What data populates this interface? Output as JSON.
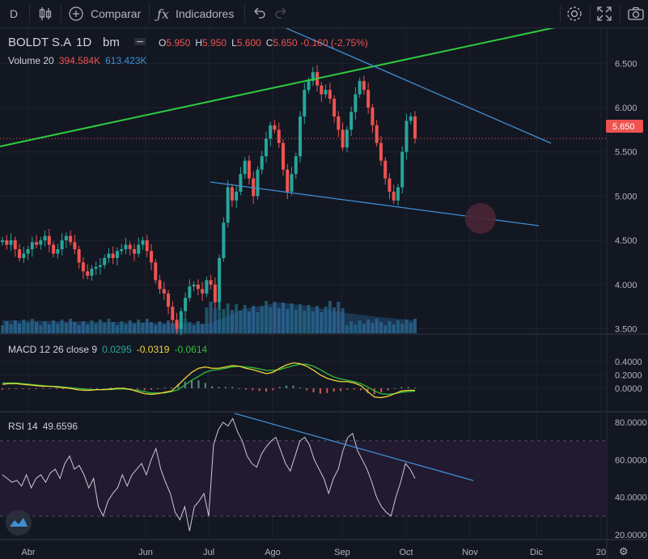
{
  "toolbar": {
    "symbol_short": "D",
    "compare_label": "Comparar",
    "indicators_label": "Indicadores"
  },
  "legend": {
    "symbol": "BOLDT S.A",
    "interval": "1D",
    "scale": "bm",
    "open_label": "O",
    "open": "5.950",
    "high_label": "H",
    "high": "5.950",
    "low_label": "L",
    "low": "5.600",
    "close_label": "C",
    "close": "5.650",
    "change": "-0.160 (-2.75%)",
    "volume_label": "Volume 20",
    "volume_value": "394.584K",
    "volume_ma": "613.423K",
    "macd_label": "MACD 12 26 close 9",
    "macd_hist": "0.0295",
    "macd_line": "-0.0319",
    "macd_signal": "-0.0614",
    "rsi_label": "RSI 14",
    "rsi_value": "49.6596"
  },
  "price_tag": "5.650",
  "colors": {
    "background": "#131722",
    "up": "#26a69a",
    "down": "#ef5350",
    "trend_green": "#2ecc40",
    "trend_blue": "#3d8fd6",
    "macd_line": "#f0d43a",
    "signal_line": "#2fbf3a",
    "rsi_line": "#c9ccd4",
    "rsi_band": "#221a30"
  },
  "chart_data": [
    {
      "type": "candlestick",
      "title": "BOLDT S.A",
      "x_ticks": [
        "Abr",
        "Jun",
        "Jul",
        "Ago",
        "Sep",
        "Oct",
        "Nov",
        "Dic",
        "20"
      ],
      "y_ticks": [
        "3.500",
        "4.000",
        "4.500",
        "5.000",
        "5.500",
        "6.000",
        "6.500"
      ],
      "ylim": [
        3.45,
        6.85
      ],
      "close": [
        4.5,
        4.45,
        4.5,
        4.4,
        4.3,
        4.35,
        4.4,
        4.48,
        4.45,
        4.5,
        4.55,
        4.45,
        4.35,
        4.4,
        4.5,
        4.55,
        4.48,
        4.4,
        4.25,
        4.15,
        4.1,
        4.18,
        4.2,
        4.22,
        4.3,
        4.35,
        4.3,
        4.38,
        4.4,
        4.45,
        4.4,
        4.35,
        4.45,
        4.5,
        4.38,
        4.25,
        4.05,
        3.95,
        3.9,
        3.75,
        3.6,
        3.5,
        3.7,
        3.85,
        3.98,
        4.0,
        3.95,
        3.9,
        4.05,
        4.0,
        3.8,
        4.3,
        4.7,
        5.1,
        4.95,
        5.05,
        5.25,
        5.4,
        5.2,
        5.0,
        5.3,
        5.45,
        5.65,
        5.8,
        5.75,
        5.6,
        5.3,
        5.05,
        5.25,
        5.45,
        5.9,
        6.2,
        6.3,
        6.4,
        6.25,
        6.15,
        6.2,
        6.1,
        5.9,
        5.75,
        5.55,
        5.75,
        5.95,
        6.15,
        6.3,
        6.2,
        6.0,
        5.8,
        5.6,
        5.4,
        5.2,
        5.05,
        4.95,
        5.1,
        5.5,
        5.85,
        5.9,
        5.65
      ],
      "volume_ma": 613423,
      "trendlines": "green rising resistance; blue falling channel",
      "last_price_marker": "5.650"
    },
    {
      "type": "line",
      "title": "MACD 12 26 close 9",
      "y_ticks": [
        "0.0000",
        "0.2000",
        "0.4000"
      ],
      "ylim": [
        -0.2,
        0.42
      ],
      "macd": [
        0.06,
        0.07,
        0.07,
        0.06,
        0.05,
        0.04,
        0.03,
        0.03,
        0.02,
        0.01,
        0.0,
        -0.02,
        -0.03,
        -0.03,
        -0.02,
        -0.02,
        -0.01,
        0.0,
        0.0,
        -0.02,
        -0.05,
        -0.08,
        -0.09,
        -0.08,
        -0.06,
        -0.04,
        0.05,
        0.15,
        0.24,
        0.3,
        0.32,
        0.3,
        0.3,
        0.32,
        0.34,
        0.33,
        0.3,
        0.28,
        0.25,
        0.22,
        0.24,
        0.3,
        0.35,
        0.38,
        0.37,
        0.33,
        0.27,
        0.2,
        0.15,
        0.12,
        0.1,
        0.1,
        0.08,
        0.04,
        -0.05,
        -0.13,
        -0.14,
        -0.12,
        -0.08,
        -0.04,
        -0.03,
        -0.03
      ],
      "signal": [
        0.08,
        0.08,
        0.08,
        0.07,
        0.06,
        0.05,
        0.04,
        0.03,
        0.03,
        0.02,
        0.01,
        0.0,
        -0.01,
        -0.02,
        -0.02,
        -0.02,
        -0.02,
        -0.01,
        -0.01,
        -0.02,
        -0.03,
        -0.05,
        -0.07,
        -0.07,
        -0.07,
        -0.05,
        -0.02,
        0.05,
        0.12,
        0.18,
        0.24,
        0.27,
        0.28,
        0.3,
        0.32,
        0.33,
        0.32,
        0.31,
        0.29,
        0.27,
        0.27,
        0.28,
        0.31,
        0.34,
        0.36,
        0.36,
        0.33,
        0.28,
        0.22,
        0.17,
        0.14,
        0.12,
        0.1,
        0.07,
        0.02,
        -0.04,
        -0.08,
        -0.09,
        -0.08,
        -0.06,
        -0.05,
        -0.04
      ]
    },
    {
      "type": "line",
      "title": "RSI 14",
      "y_ticks": [
        "20.0000",
        "40.0000",
        "60.0000",
        "80.0000"
      ],
      "ylim": [
        18,
        82
      ],
      "band": [
        30,
        70
      ],
      "values": [
        52,
        50,
        48,
        49,
        46,
        52,
        45,
        50,
        52,
        48,
        53,
        55,
        50,
        58,
        62,
        55,
        57,
        52,
        45,
        50,
        35,
        30,
        38,
        42,
        45,
        52,
        46,
        52,
        55,
        58,
        52,
        60,
        66,
        55,
        48,
        42,
        32,
        28,
        35,
        22,
        35,
        38,
        42,
        30,
        68,
        76,
        80,
        78,
        82,
        75,
        70,
        62,
        58,
        56,
        63,
        67,
        70,
        72,
        65,
        58,
        54,
        62,
        70,
        72,
        68,
        60,
        55,
        50,
        42,
        50,
        55,
        65,
        72,
        74,
        65,
        60,
        55,
        48,
        40,
        35,
        32,
        30,
        40,
        48,
        58,
        55,
        50
      ]
    }
  ]
}
